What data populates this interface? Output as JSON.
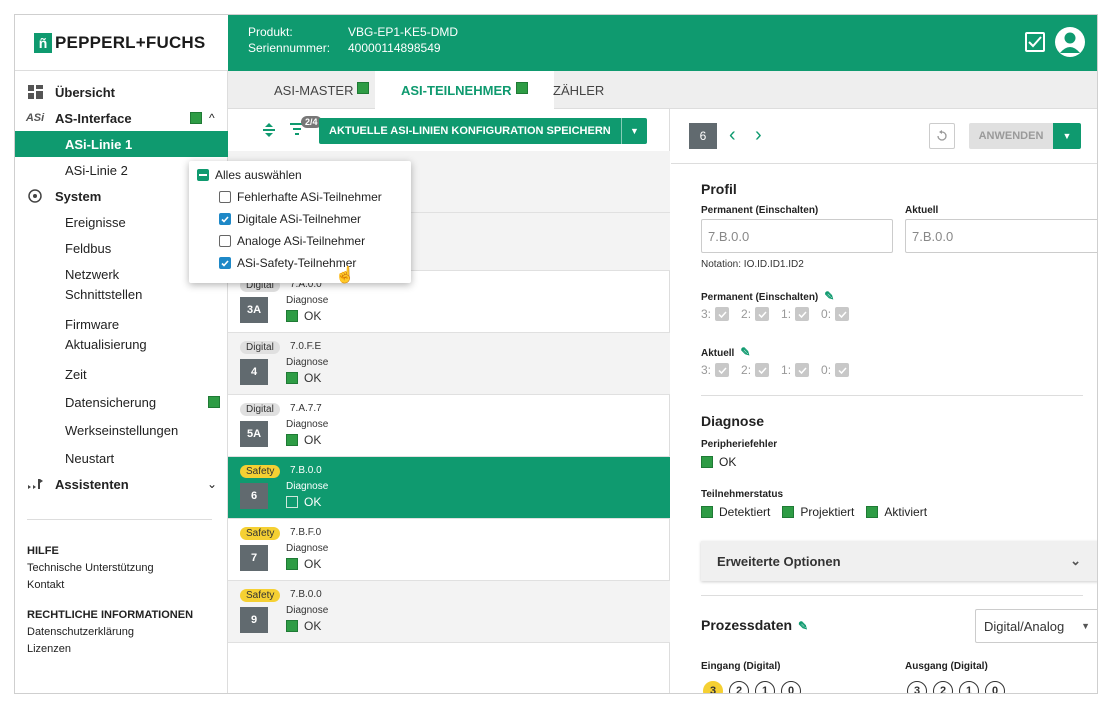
{
  "brand": {
    "mark": "ñ",
    "name": "PEPPERL+FUCHS"
  },
  "header": {
    "product_label": "Produkt:",
    "product_value": "VBG-EP1-KE5-DMD",
    "serial_label": "Seriennummer:",
    "serial_value": "40000114898549"
  },
  "sidebar": {
    "overview": "Übersicht",
    "asi_interface": "AS-Interface",
    "asi_line1": "ASi-Linie 1",
    "asi_line2": "ASi-Linie 2",
    "system": "System",
    "events": "Ereignisse",
    "fieldbus": "Feldbus",
    "network_1": "Netzwerk",
    "network_2": "Schnittstellen",
    "firmware_1": "Firmware",
    "firmware_2": "Aktualisierung",
    "time": "Zeit",
    "backup": "Datensicherung",
    "factory": "Werkseinstellungen",
    "restart": "Neustart",
    "assistants": "Assistenten",
    "help": "HILFE",
    "tech_support": "Technische Unterstützung",
    "contact": "Kontakt",
    "legal": "RECHTLICHE INFORMATIONEN",
    "privacy": "Datenschutzerklärung",
    "licenses": "Lizenzen"
  },
  "tabs": [
    "ASI-MASTER",
    "ASI-TEILNEHMER",
    "ZÄHLER"
  ],
  "toolbar": {
    "filter_count": "2/4",
    "save_label": "AKTUELLE ASI-LINIEN KONFIGURATION SPEICHERN"
  },
  "filter_popup": {
    "select_all": "Alles auswählen",
    "items": [
      {
        "label": "Fehlerhafte ASi-Teilnehmer",
        "checked": false
      },
      {
        "label": "Digitale ASi-Teilnehmer",
        "checked": true
      },
      {
        "label": "Analoge ASi-Teilnehmer",
        "checked": false
      },
      {
        "label": "ASi-Safety-Teilnehmer",
        "checked": true
      }
    ]
  },
  "devices": [
    {
      "type": "Digital",
      "profile": "7.A.0.0",
      "node": "3A",
      "diag": "Diagnose",
      "status": "OK"
    },
    {
      "type": "Digital",
      "profile": "7.0.F.E",
      "node": "4",
      "diag": "Diagnose",
      "status": "OK"
    },
    {
      "type": "Digital",
      "profile": "7.A.7.7",
      "node": "5A",
      "diag": "Diagnose",
      "status": "OK"
    },
    {
      "type": "Safety",
      "profile": "7.B.0.0",
      "node": "6",
      "diag": "Diagnose",
      "status": "OK"
    },
    {
      "type": "Safety",
      "profile": "7.B.F.0",
      "node": "7",
      "diag": "Diagnose",
      "status": "OK"
    },
    {
      "type": "Safety",
      "profile": "7.B.0.0",
      "node": "9",
      "diag": "Diagnose",
      "status": "OK"
    }
  ],
  "detail": {
    "node": "6",
    "apply_label": "ANWENDEN",
    "profile_title": "Profil",
    "perm_label": "Permanent (Einschalten)",
    "perm_value": "7.B.0.0",
    "current_label": "Aktuell",
    "current_value": "7.B.0.0",
    "notation": "Notation: IO.ID.ID1.ID2",
    "perm_bits_label": "Permanent (Einschalten)",
    "current_bits_label": "Aktuell",
    "bits": [
      "3:",
      "2:",
      "1:",
      "0:"
    ],
    "diag_title": "Diagnose",
    "periph_label": "Peripheriefehler",
    "periph_value": "OK",
    "status_label": "Teilnehmerstatus",
    "status_items": [
      "Detektiert",
      "Projektiert",
      "Aktiviert"
    ],
    "ext_options": "Erweiterte Optionen",
    "process_title": "Prozessdaten",
    "process_select": "Digital/Analog",
    "input_label": "Eingang (Digital)",
    "output_label": "Ausgang (Digital)",
    "input_bits": [
      "3",
      "2",
      "1",
      "0"
    ],
    "output_bits": [
      "3",
      "2",
      "1",
      "0"
    ]
  }
}
